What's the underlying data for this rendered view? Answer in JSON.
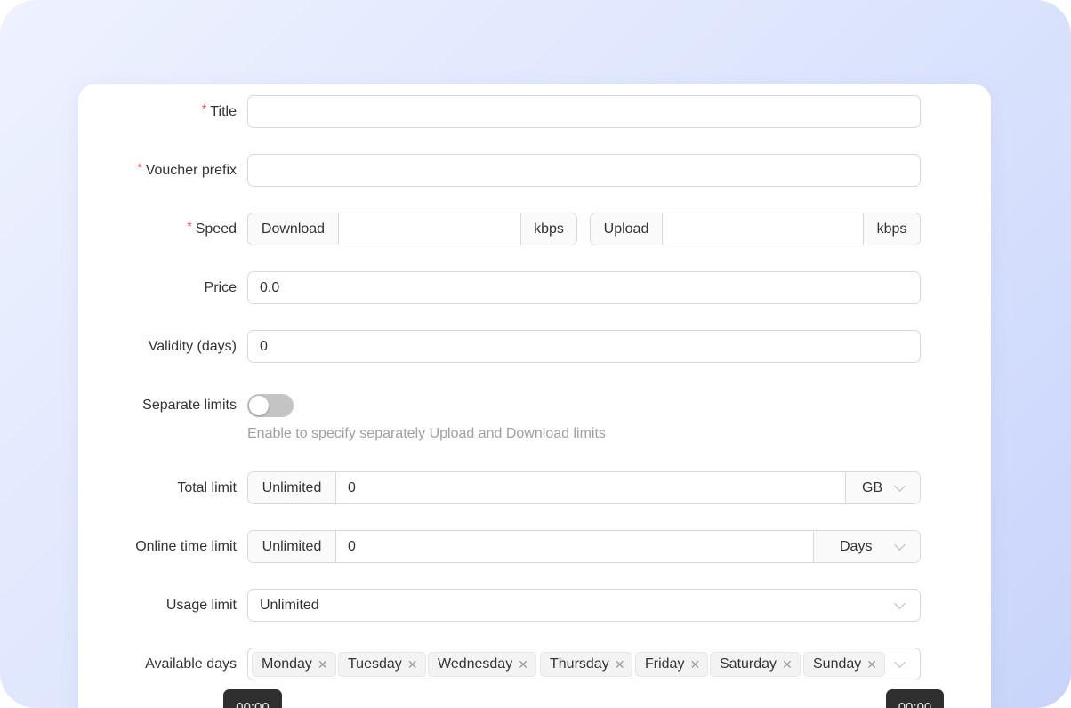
{
  "form": {
    "title": {
      "label": "Title",
      "value": ""
    },
    "voucher_prefix": {
      "label": "Voucher prefix",
      "value": ""
    },
    "speed": {
      "label": "Speed",
      "download_label": "Download",
      "download_value": "",
      "download_unit": "kbps",
      "upload_label": "Upload",
      "upload_value": "",
      "upload_unit": "kbps"
    },
    "price": {
      "label": "Price",
      "value": "0.0"
    },
    "validity": {
      "label": "Validity (days)",
      "value": "0"
    },
    "separate_limits": {
      "label": "Separate limits",
      "enabled": false,
      "help": "Enable to specify separately Upload and Download limits"
    },
    "total_limit": {
      "label": "Total limit",
      "mode": "Unlimited",
      "value": "0",
      "unit": "GB"
    },
    "online_time_limit": {
      "label": "Online time limit",
      "mode": "Unlimited",
      "value": "0",
      "unit": "Days"
    },
    "usage_limit": {
      "label": "Usage limit",
      "value": "Unlimited"
    },
    "available_days": {
      "label": "Available days",
      "tags": [
        "Monday",
        "Tuesday",
        "Wednesday",
        "Thursday",
        "Friday",
        "Saturday",
        "Sunday"
      ]
    },
    "time_start": "00:00",
    "time_end": "00:00"
  },
  "colors": {
    "required_mark": "#ff4d4f",
    "border": "#d9d9d9",
    "switch_off": "#c4c4c4",
    "tooltip_bg": "#2f2f2f"
  }
}
